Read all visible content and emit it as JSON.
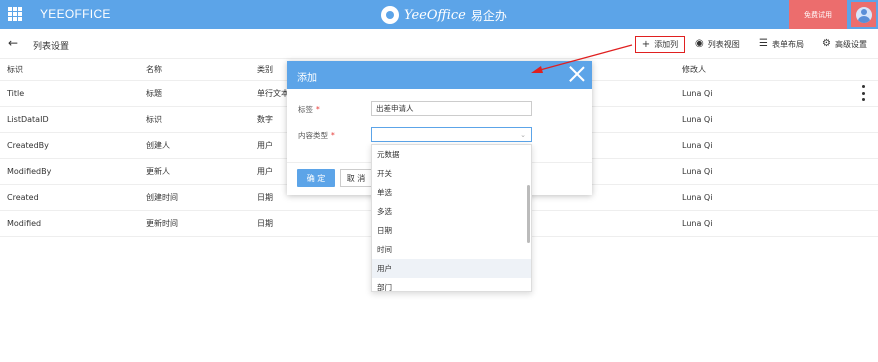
{
  "app": {
    "title": "YEEOFFICE",
    "brand_en": "YeeOffice",
    "brand_cn": "易企办",
    "trial_label": "免费试用"
  },
  "header": {
    "page_title": "列表设置",
    "toolbar": {
      "add_column": "添加列",
      "list_view": "列表视图",
      "form_layout": "表单布局",
      "advanced": "高级设置"
    }
  },
  "table": {
    "columns": [
      "标识",
      "名称",
      "类别",
      "修改人"
    ],
    "rows": [
      {
        "id": "Title",
        "name": "标题",
        "type": "单行文本",
        "modifier": "Luna Qi"
      },
      {
        "id": "ListDataID",
        "name": "标识",
        "type": "数字",
        "modifier": "Luna Qi"
      },
      {
        "id": "CreatedBy",
        "name": "创建人",
        "type": "用户",
        "modifier": "Luna Qi"
      },
      {
        "id": "ModifiedBy",
        "name": "更新人",
        "type": "用户",
        "modifier": "Luna Qi"
      },
      {
        "id": "Created",
        "name": "创建时间",
        "type": "日期",
        "modifier": "Luna Qi"
      },
      {
        "id": "Modified",
        "name": "更新时间",
        "type": "日期",
        "modifier": "Luna Qi"
      }
    ]
  },
  "dialog": {
    "title": "添加",
    "label_field": "标签",
    "label_value": "出差申请人",
    "type_field": "内容类型",
    "type_value": "",
    "required_mark": "*",
    "ok": "确 定",
    "cancel": "取 消"
  },
  "dropdown": {
    "options": [
      "元数据",
      "开关",
      "单选",
      "多选",
      "日期",
      "时间",
      "用户",
      "部门"
    ],
    "highlighted": "用户"
  },
  "colors": {
    "primary": "#5ca4e8",
    "trial": "#ec6d6d",
    "annotation": "#e02020"
  }
}
